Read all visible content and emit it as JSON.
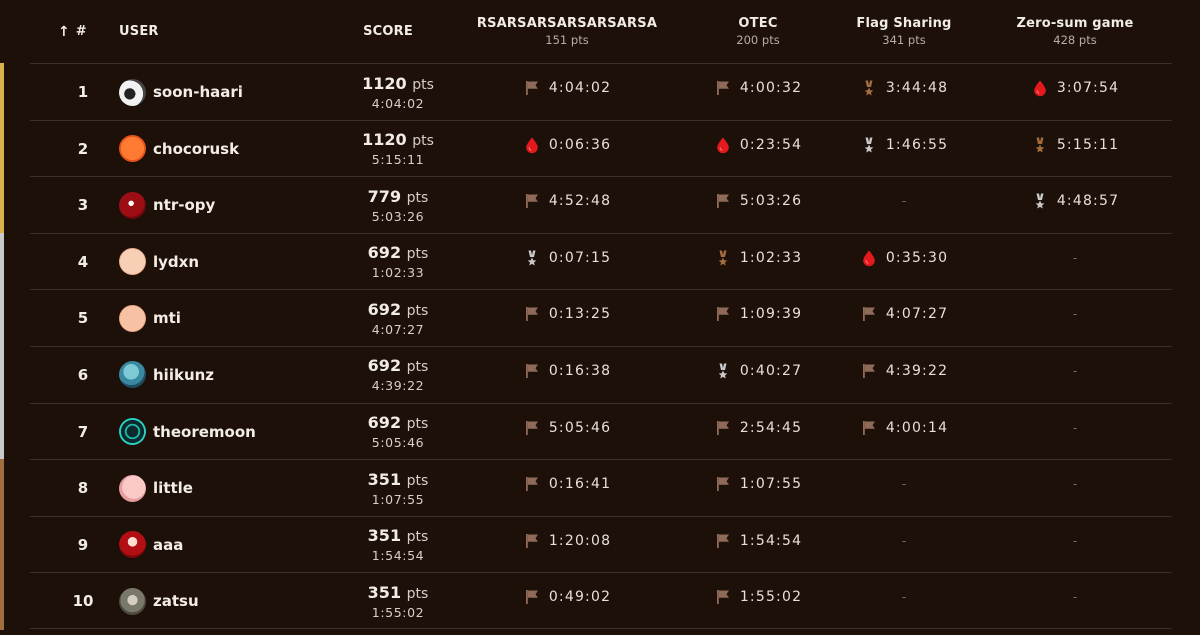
{
  "header": {
    "rank_label": "#",
    "user_label": "USER",
    "score_label": "SCORE",
    "challenges": [
      {
        "name": "RSARSARSARSARSARSA",
        "points": "151 pts"
      },
      {
        "name": "OTEC",
        "points": "200 pts"
      },
      {
        "name": "Flag Sharing",
        "points": "341 pts"
      },
      {
        "name": "Zero-sum game",
        "points": "428 pts"
      }
    ]
  },
  "colors": {
    "gold": "#d8b24a",
    "silver": "#c9c9c9",
    "bronze": "#a36e3f",
    "first_blood": "#e3191d",
    "flag": "#8f6a58"
  },
  "rows": [
    {
      "rank": "1",
      "user": "soon-haari",
      "score": "1120",
      "unit": "pts",
      "time": "4:04:02",
      "solves": [
        {
          "icon": "flag-icon",
          "time": "4:04:02"
        },
        {
          "icon": "flag-icon",
          "time": "4:00:32"
        },
        {
          "icon": "bronze-medal-icon",
          "time": "3:44:48"
        },
        {
          "icon": "first-blood-icon",
          "time": "3:07:54"
        }
      ]
    },
    {
      "rank": "2",
      "user": "chocorusk",
      "score": "1120",
      "unit": "pts",
      "time": "5:15:11",
      "solves": [
        {
          "icon": "first-blood-icon",
          "time": "0:06:36"
        },
        {
          "icon": "first-blood-icon",
          "time": "0:23:54"
        },
        {
          "icon": "silver-medal-icon",
          "time": "1:46:55"
        },
        {
          "icon": "bronze-medal-icon",
          "time": "5:15:11"
        }
      ]
    },
    {
      "rank": "3",
      "user": "ntr-opy",
      "score": "779",
      "unit": "pts",
      "time": "5:03:26",
      "solves": [
        {
          "icon": "flag-icon",
          "time": "4:52:48"
        },
        {
          "icon": "flag-icon",
          "time": "5:03:26"
        },
        {
          "icon": "none",
          "time": "-"
        },
        {
          "icon": "silver-medal-icon",
          "time": "4:48:57"
        }
      ]
    },
    {
      "rank": "4",
      "user": "lydxn",
      "score": "692",
      "unit": "pts",
      "time": "1:02:33",
      "solves": [
        {
          "icon": "silver-medal-icon",
          "time": "0:07:15"
        },
        {
          "icon": "bronze-medal-icon",
          "time": "1:02:33"
        },
        {
          "icon": "first-blood-icon",
          "time": "0:35:30"
        },
        {
          "icon": "none",
          "time": "-"
        }
      ]
    },
    {
      "rank": "5",
      "user": "mti",
      "score": "692",
      "unit": "pts",
      "time": "4:07:27",
      "solves": [
        {
          "icon": "flag-icon",
          "time": "0:13:25"
        },
        {
          "icon": "flag-icon",
          "time": "1:09:39"
        },
        {
          "icon": "flag-icon",
          "time": "4:07:27"
        },
        {
          "icon": "none",
          "time": "-"
        }
      ]
    },
    {
      "rank": "6",
      "user": "hiikunz",
      "score": "692",
      "unit": "pts",
      "time": "4:39:22",
      "solves": [
        {
          "icon": "flag-icon",
          "time": "0:16:38"
        },
        {
          "icon": "silver-medal-icon",
          "time": "0:40:27"
        },
        {
          "icon": "flag-icon",
          "time": "4:39:22"
        },
        {
          "icon": "none",
          "time": "-"
        }
      ]
    },
    {
      "rank": "7",
      "user": "theoremoon",
      "score": "692",
      "unit": "pts",
      "time": "5:05:46",
      "solves": [
        {
          "icon": "flag-icon",
          "time": "5:05:46"
        },
        {
          "icon": "flag-icon",
          "time": "2:54:45"
        },
        {
          "icon": "flag-icon",
          "time": "4:00:14"
        },
        {
          "icon": "none",
          "time": "-"
        }
      ]
    },
    {
      "rank": "8",
      "user": "little",
      "score": "351",
      "unit": "pts",
      "time": "1:07:55",
      "solves": [
        {
          "icon": "flag-icon",
          "time": "0:16:41"
        },
        {
          "icon": "flag-icon",
          "time": "1:07:55"
        },
        {
          "icon": "none",
          "time": "-"
        },
        {
          "icon": "none",
          "time": "-"
        }
      ]
    },
    {
      "rank": "9",
      "user": "aaa",
      "score": "351",
      "unit": "pts",
      "time": "1:54:54",
      "solves": [
        {
          "icon": "flag-icon",
          "time": "1:20:08"
        },
        {
          "icon": "flag-icon",
          "time": "1:54:54"
        },
        {
          "icon": "none",
          "time": "-"
        },
        {
          "icon": "none",
          "time": "-"
        }
      ]
    },
    {
      "rank": "10",
      "user": "zatsu",
      "score": "351",
      "unit": "pts",
      "time": "1:55:02",
      "solves": [
        {
          "icon": "flag-icon",
          "time": "0:49:02"
        },
        {
          "icon": "flag-icon",
          "time": "1:55:02"
        },
        {
          "icon": "none",
          "time": "-"
        },
        {
          "icon": "none",
          "time": "-"
        }
      ]
    }
  ]
}
